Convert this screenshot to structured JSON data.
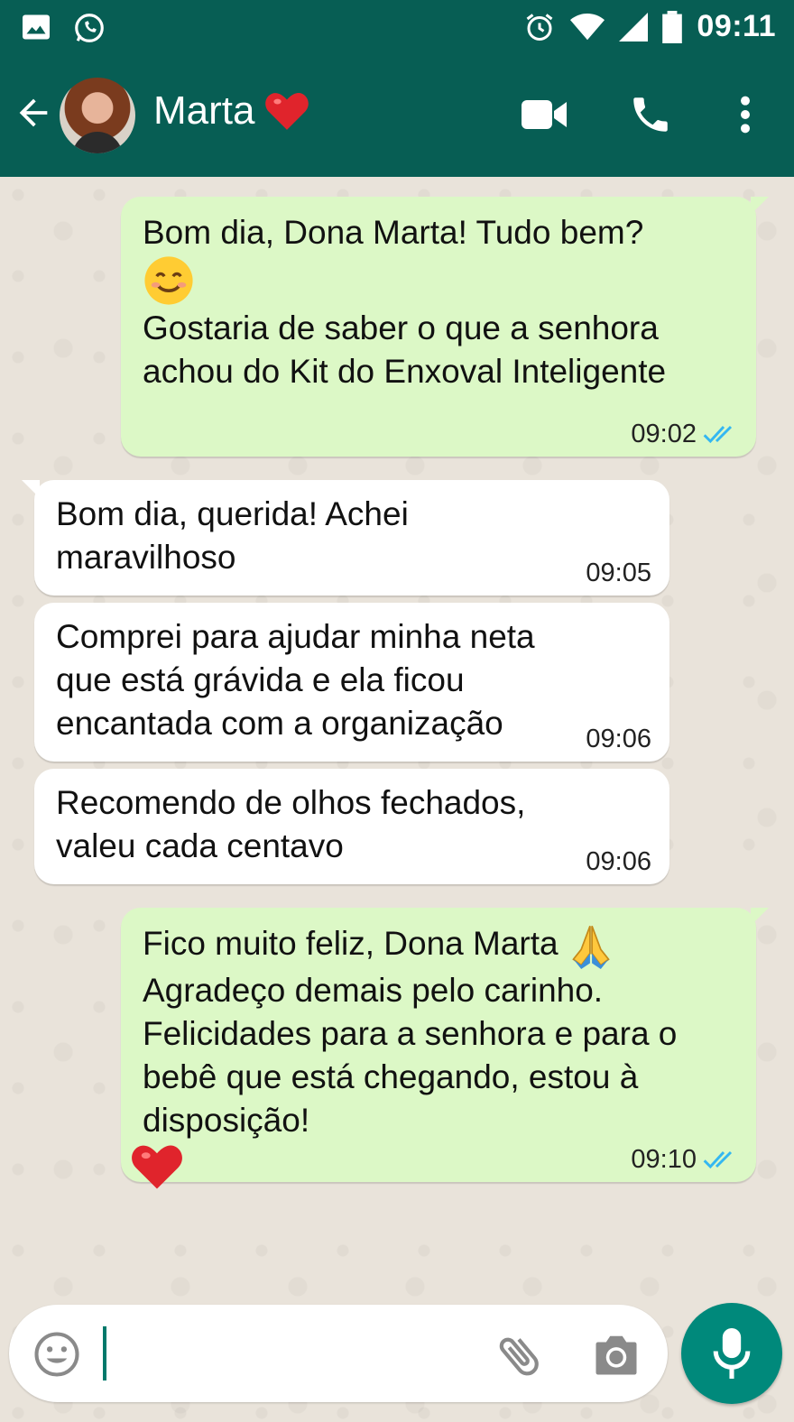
{
  "status_bar": {
    "time": "09:11"
  },
  "header": {
    "contact_name": "Marta"
  },
  "messages": [
    {
      "direction": "out",
      "lines": [
        "Bom dia, Dona Marta! Tudo bem?",
        "Gostaria de saber o que a senhora achou do Kit do Enxoval Inteligente"
      ],
      "time": "09:02",
      "read": true
    },
    {
      "direction": "in",
      "text": "Bom dia, querida! Achei maravilhoso",
      "time": "09:05"
    },
    {
      "direction": "in",
      "text": "Comprei para ajudar minha neta que está grávida e ela ficou encantada com a organização",
      "time": "09:06"
    },
    {
      "direction": "in",
      "text": "Recomendo de olhos fechados, valeu cada centavo",
      "time": "09:06"
    },
    {
      "direction": "out",
      "lines": [
        "Fico muito feliz, Dona Marta",
        "Agradeço demais pelo carinho. Felicidades para a senhora e para o bebê que está chegando, estou à disposição!"
      ],
      "time": "09:10",
      "read": true
    }
  ],
  "colors": {
    "header": "#075e54",
    "outgoing_bubble": "#dcf8c6",
    "incoming_bubble": "#ffffff",
    "read_ticks": "#34b7f1",
    "fab": "#00897b"
  },
  "icons": [
    "image-icon",
    "whatsapp-icon",
    "alarm-icon",
    "wifi-icon",
    "signal-icon",
    "battery-icon",
    "back-arrow-icon",
    "heart-icon",
    "video-call-icon",
    "phone-icon",
    "more-vert-icon",
    "smile-emoji-icon",
    "pray-emoji-icon",
    "emoji-icon",
    "attach-icon",
    "camera-icon",
    "mic-icon"
  ]
}
